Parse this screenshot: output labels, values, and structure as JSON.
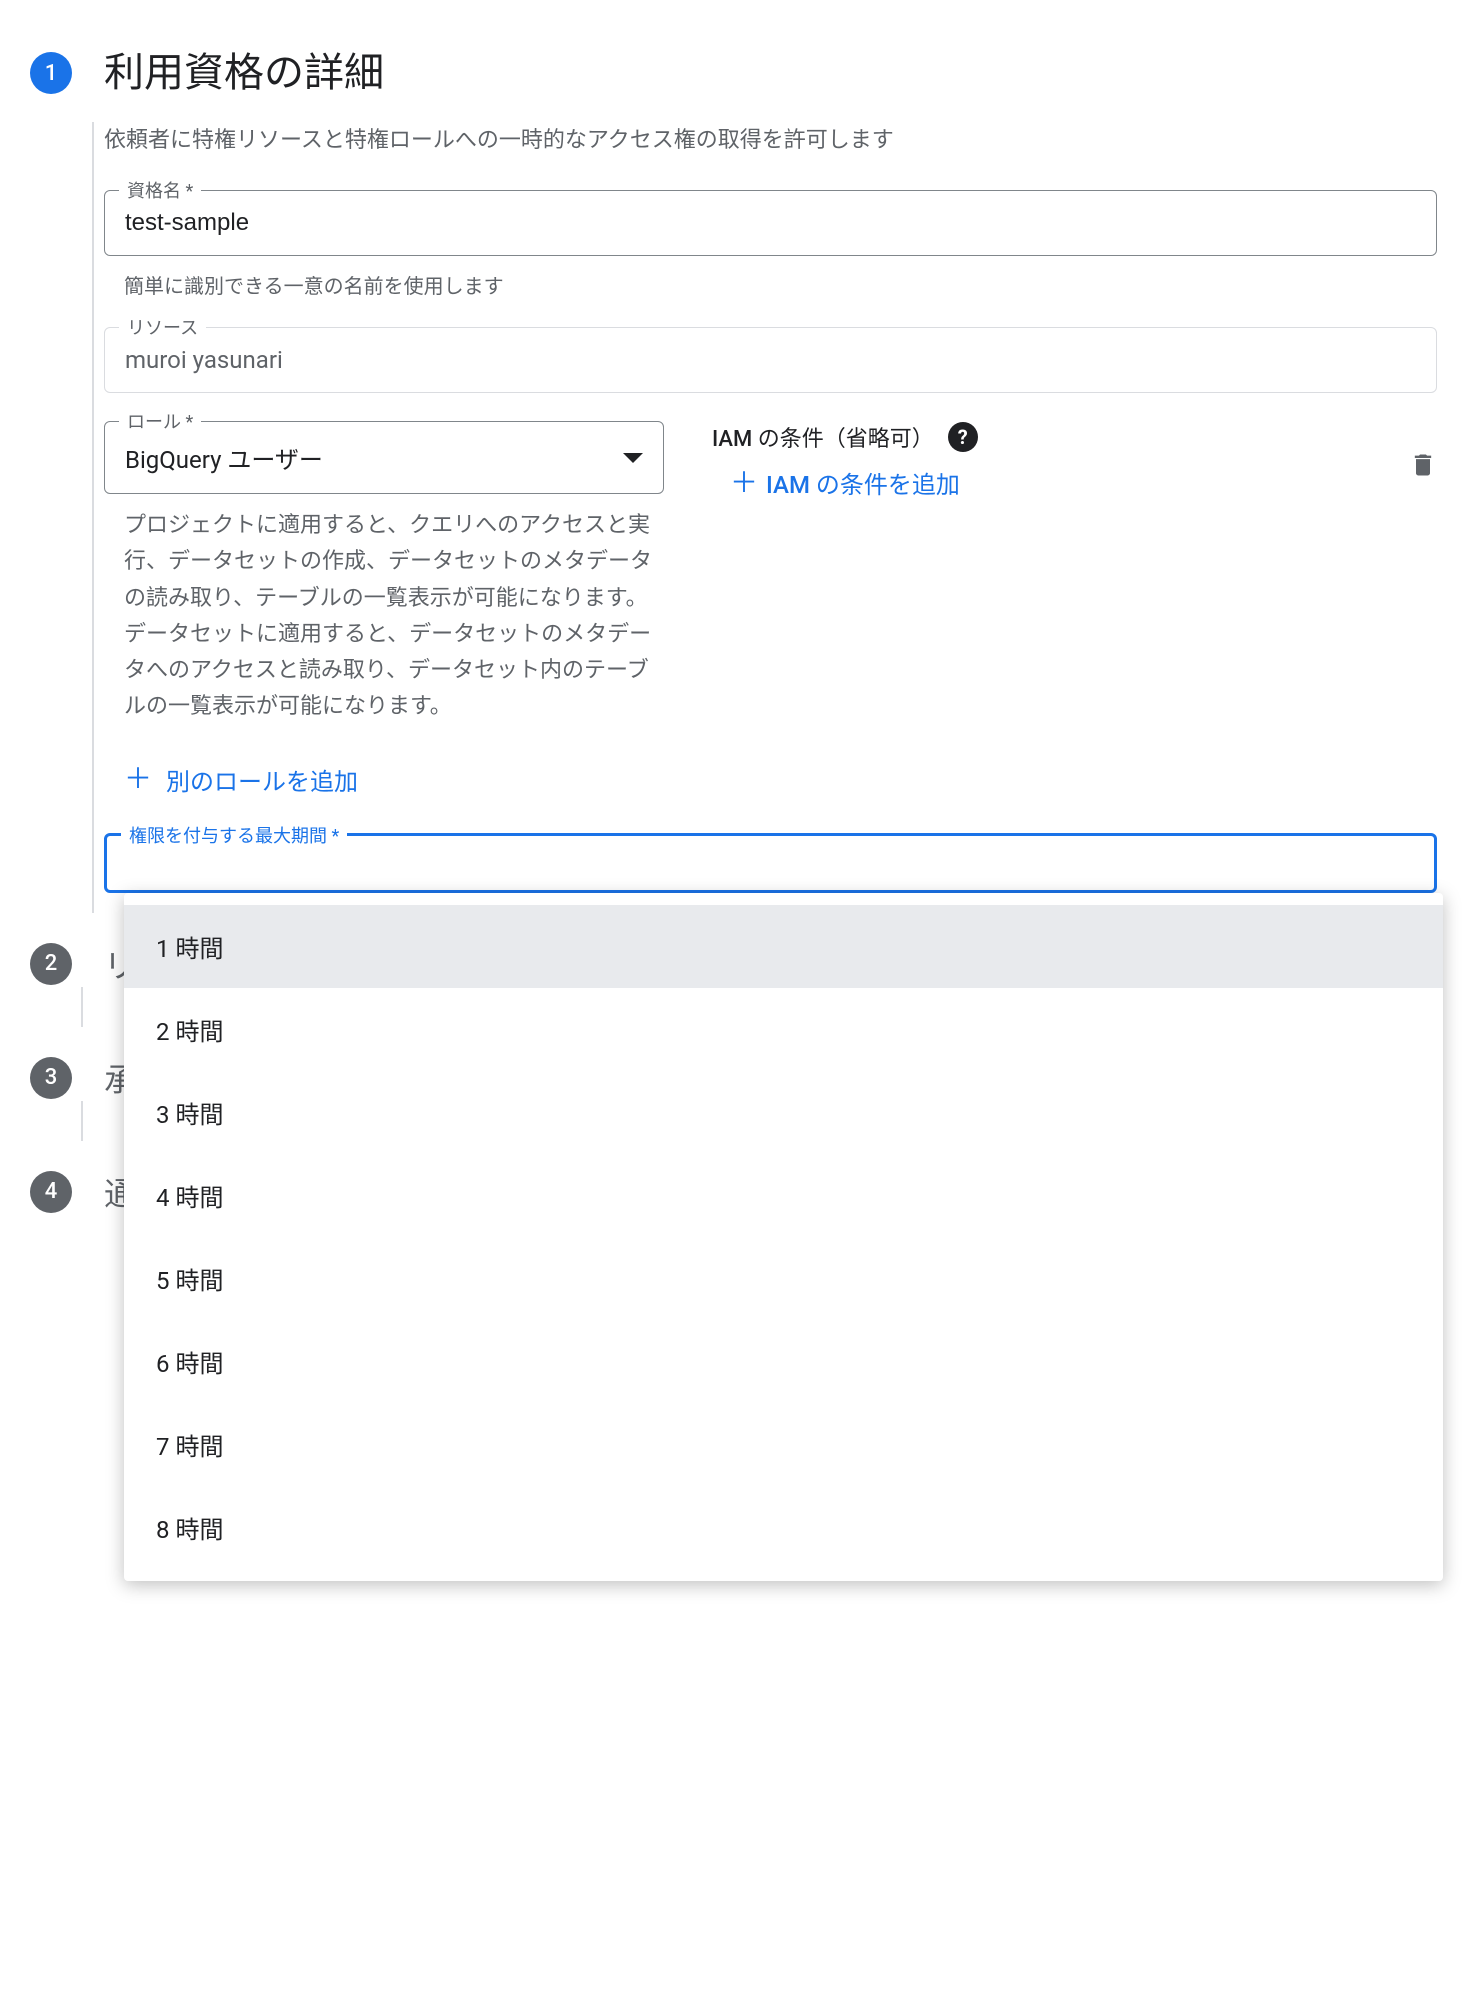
{
  "step1": {
    "number": "1",
    "title": "利用資格の詳細",
    "subtitle": "依頼者に特権リソースと特権ロールへの一時的なアクセス権の取得を許可します",
    "name_field": {
      "label": "資格名 *",
      "value": "test-sample",
      "helper": "簡単に識別できる一意の名前を使用します"
    },
    "resource_field": {
      "label": "リソース",
      "value": "muroi yasunari"
    },
    "role_field": {
      "label": "ロール *",
      "value": "BigQuery ユーザー",
      "description": "プロジェクトに適用すると、クエリへのアクセスと実行、データセットの作成、データセットのメタデータの読み取り、テーブルの一覧表示が可能になります。データセットに適用すると、データセットのメタデータへのアクセスと読み取り、データセット内のテーブルの一覧表示が可能になります。"
    },
    "iam": {
      "header": "IAM の条件（省略可）",
      "add_label": "IAM の条件を追加"
    },
    "add_role": "別のロールを追加",
    "duration_field": {
      "label": "権限を付与する最大期間 *",
      "options": [
        "1 時間",
        "2 時間",
        "3 時間",
        "4 時間",
        "5 時間",
        "6 時間",
        "7 時間",
        "8 時間"
      ],
      "selected_index": 0
    }
  },
  "step2": {
    "number": "2",
    "title": "リ"
  },
  "step3": {
    "number": "3",
    "title": "承"
  },
  "step4": {
    "number": "4",
    "title": "通"
  }
}
